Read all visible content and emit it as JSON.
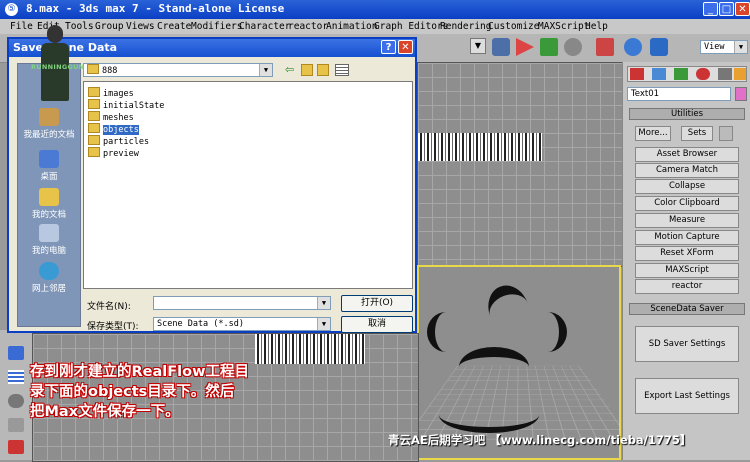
{
  "window": {
    "title": "8.max - 3ds max 7  - Stand-alone License"
  },
  "menu": [
    "File",
    "Edit",
    "Tools",
    "Group",
    "Views",
    "Create",
    "Modifiers",
    "Character",
    "reactor",
    "Animation",
    "Graph Editors",
    "Rendering",
    "Customize",
    "MAXScript",
    "Help"
  ],
  "toolbar": {
    "view_dropdown": "View"
  },
  "command_panel": {
    "object_name": "Text01",
    "utilities_title": "Utilities",
    "more_button": "More...",
    "sets_button": "Sets",
    "utility_buttons": [
      "Asset Browser",
      "Camera Match",
      "Collapse",
      "Color Clipboard",
      "Measure",
      "Motion Capture",
      "Reset XForm",
      "MAXScript",
      "reactor"
    ],
    "scene_saver_title": "SceneData Saver",
    "sd_saver_settings": "SD Saver Settings",
    "export_last_settings": "Export Last Settings"
  },
  "dialog": {
    "title": "Save Scene Data",
    "look_in": "888",
    "places": [
      "我最近的文档",
      "桌面",
      "我的文档",
      "我的电脑",
      "网上邻居"
    ],
    "folders": [
      "images",
      "initialState",
      "meshes",
      "objects",
      "particles",
      "preview"
    ],
    "selected_folder": "objects",
    "filename_label": "文件名(N):",
    "filename_value": "",
    "filetype_label": "保存类型(T):",
    "filetype_value": "Scene Data (*.sd)",
    "save_button": "打开(O)",
    "cancel_button": "取消",
    "help_glyph": "?",
    "close_glyph": "✕"
  },
  "overlay": {
    "avatar_text": "RUNNINGGUN",
    "caption_lines": [
      "存到刚才建立的RealFlow工程目",
      "录下面的objects目录下。然后",
      "把Max文件保存一下。"
    ],
    "watermark": "青云AE后期学习吧 【www.linecg.com/tieba/1775】"
  },
  "colors": {
    "titlebar": "#0a3fc4",
    "selection": "#316ac5",
    "active_viewport": "#e8d84a",
    "caption_outline": "#c00000"
  }
}
